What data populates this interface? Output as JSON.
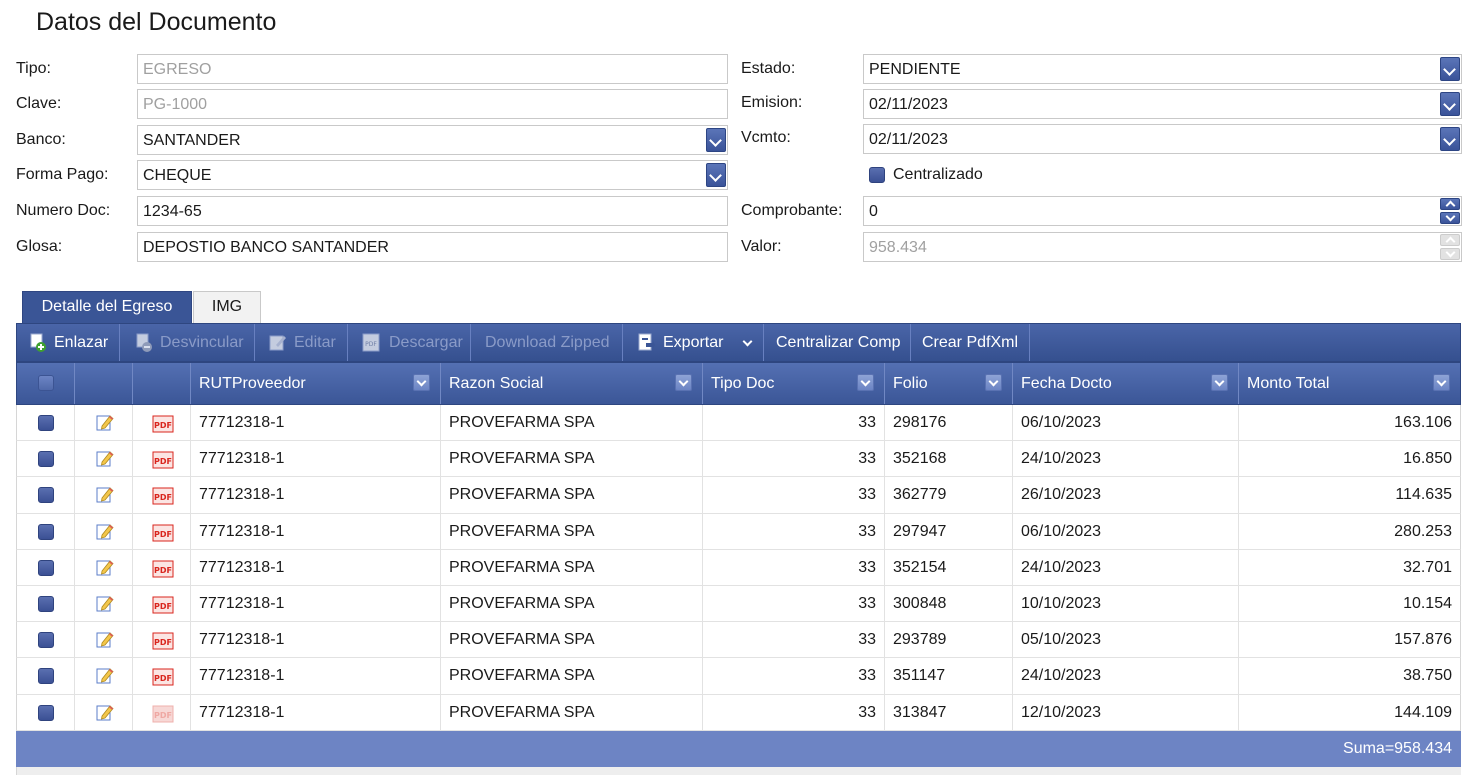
{
  "title": "Datos del Documento",
  "form": {
    "tipo": {
      "label": "Tipo:",
      "value": "EGRESO"
    },
    "clave": {
      "label": "Clave:",
      "value": "PG-1000"
    },
    "banco": {
      "label": "Banco:",
      "value": "SANTANDER"
    },
    "forma_pago": {
      "label": "Forma Pago:",
      "value": "CHEQUE"
    },
    "numero_doc": {
      "label": "Numero Doc:",
      "value": "1234-65"
    },
    "glosa": {
      "label": "Glosa:",
      "value": "DEPOSTIO BANCO SANTANDER"
    },
    "estado": {
      "label": "Estado:",
      "value": "PENDIENTE"
    },
    "emision": {
      "label": "Emision:",
      "value": "02/11/2023"
    },
    "vcmto": {
      "label": "Vcmto:",
      "value": "02/11/2023"
    },
    "centralizado": {
      "label": "Centralizado",
      "checked": true
    },
    "comprobante": {
      "label": "Comprobante:",
      "value": "0"
    },
    "valor": {
      "label": "Valor:",
      "value": "958.434"
    }
  },
  "tabs": [
    {
      "label": "Detalle del Egreso",
      "active": true
    },
    {
      "label": "IMG",
      "active": false
    }
  ],
  "toolbar": {
    "enlazar": "Enlazar",
    "desvincular": "Desvincular",
    "editar": "Editar",
    "descargar": "Descargar",
    "download_zipped": "Download Zipped",
    "exportar": "Exportar",
    "centralizar": "Centralizar Comp",
    "crear_pdfxml": "Crear PdfXml"
  },
  "grid": {
    "columns": [
      "RUTProveedor",
      "Razon Social",
      "Tipo Doc",
      "Folio",
      "Fecha Docto",
      "Monto Total"
    ],
    "rows": [
      {
        "rut": "77712318-1",
        "razon": "PROVEFARMA SPA",
        "tipo": "33",
        "folio": "298176",
        "fecha": "06/10/2023",
        "monto": "163.106"
      },
      {
        "rut": "77712318-1",
        "razon": "PROVEFARMA SPA",
        "tipo": "33",
        "folio": "352168",
        "fecha": "24/10/2023",
        "monto": "16.850"
      },
      {
        "rut": "77712318-1",
        "razon": "PROVEFARMA SPA",
        "tipo": "33",
        "folio": "362779",
        "fecha": "26/10/2023",
        "monto": "114.635"
      },
      {
        "rut": "77712318-1",
        "razon": "PROVEFARMA SPA",
        "tipo": "33",
        "folio": "297947",
        "fecha": "06/10/2023",
        "monto": "280.253"
      },
      {
        "rut": "77712318-1",
        "razon": "PROVEFARMA SPA",
        "tipo": "33",
        "folio": "352154",
        "fecha": "24/10/2023",
        "monto": "32.701"
      },
      {
        "rut": "77712318-1",
        "razon": "PROVEFARMA SPA",
        "tipo": "33",
        "folio": "300848",
        "fecha": "10/10/2023",
        "monto": "10.154"
      },
      {
        "rut": "77712318-1",
        "razon": "PROVEFARMA SPA",
        "tipo": "33",
        "folio": "293789",
        "fecha": "05/10/2023",
        "monto": "157.876"
      },
      {
        "rut": "77712318-1",
        "razon": "PROVEFARMA SPA",
        "tipo": "33",
        "folio": "351147",
        "fecha": "24/10/2023",
        "monto": "38.750"
      },
      {
        "rut": "77712318-1",
        "razon": "PROVEFARMA SPA",
        "tipo": "33",
        "folio": "313847",
        "fecha": "12/10/2023",
        "monto": "144.109"
      }
    ],
    "footer": "Suma=958.434"
  },
  "colors": {
    "accent": "#3a5596",
    "footer": "#6d84c4",
    "pdf_red": "#d9251d"
  }
}
